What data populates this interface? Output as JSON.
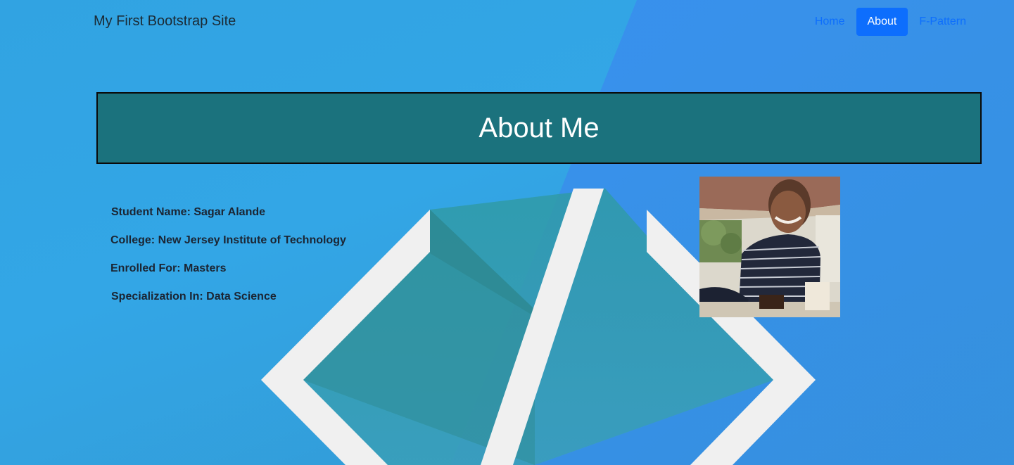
{
  "navbar": {
    "brand": "My First Bootstrap Site",
    "links": [
      {
        "label": "Home",
        "active": false
      },
      {
        "label": "About",
        "active": true
      },
      {
        "label": "F-Pattern",
        "active": false
      }
    ]
  },
  "main": {
    "heading": "About Me",
    "details": [
      "Student Name: Sagar Alande",
      "College: New Jersey Institute of Technology",
      "Enrolled For: Masters",
      "Specialization In: Data Science"
    ],
    "photo_icon": "profile-photo"
  },
  "colors": {
    "accent": "#0d6efd",
    "header_bg": "#1b727d",
    "page_bg": "#33a6e6"
  }
}
